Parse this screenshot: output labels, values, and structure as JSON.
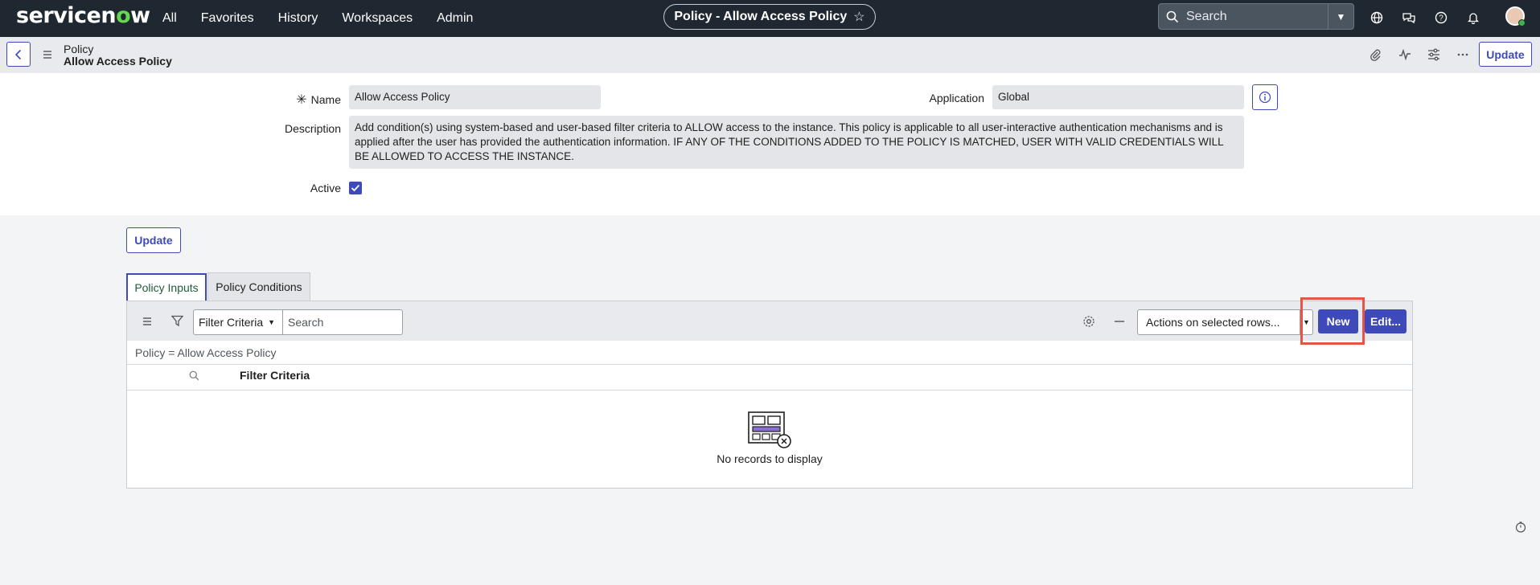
{
  "topnav": {
    "logo": "servicenow",
    "links": [
      "All",
      "Favorites",
      "History",
      "Workspaces",
      "Admin"
    ],
    "record_pill": "Policy - Allow Access Policy",
    "search_placeholder": "Search"
  },
  "form_header": {
    "table": "Policy",
    "record": "Allow Access Policy",
    "update_label": "Update"
  },
  "form": {
    "name_label": "Name",
    "name_value": "Allow Access Policy",
    "application_label": "Application",
    "application_value": "Global",
    "description_label": "Description",
    "description_value": "Add condition(s) using system-based and user-based filter criteria to ALLOW access to the instance. This policy is applicable to all user-interactive authentication mechanisms and is applied after the user has provided the authentication information. IF ANY OF THE CONDITIONS ADDED TO THE POLICY IS MATCHED, USER WITH VALID CREDENTIALS WILL BE ALLOWED TO ACCESS THE INSTANCE.",
    "active_label": "Active",
    "active_checked": true
  },
  "lower": {
    "update_label": "Update",
    "tabs": [
      "Policy Inputs",
      "Policy Conditions"
    ],
    "active_tab": "Policy Inputs"
  },
  "list": {
    "filter_select": "Filter Criteria",
    "search_placeholder": "Search",
    "actions_select": "Actions on selected rows...",
    "new_label": "New",
    "edit_label": "Edit...",
    "breadcrumb": "Policy = Allow Access Policy",
    "column_header": "Filter Criteria",
    "empty_text": "No records to display"
  },
  "colors": {
    "nav_bg": "#1f2730",
    "primary": "#3e49ba",
    "highlight": "#e5534b",
    "logo_accent": "#62d84e"
  }
}
